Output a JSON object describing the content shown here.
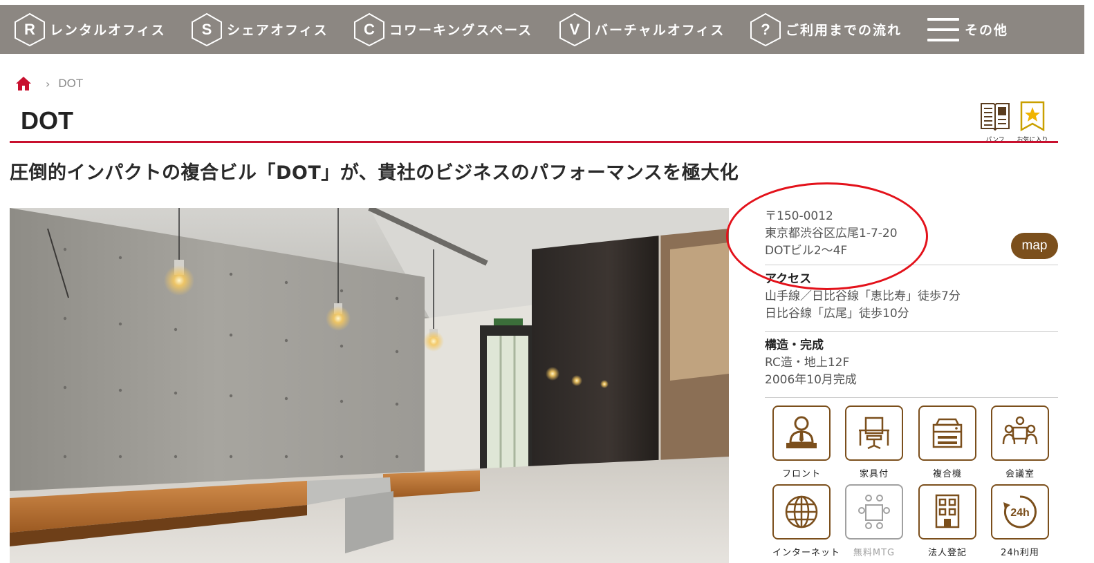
{
  "nav": {
    "items": [
      {
        "letter": "R",
        "label": "レンタルオフィス"
      },
      {
        "letter": "S",
        "label": "シェアオフィス"
      },
      {
        "letter": "C",
        "label": "コワーキングスペース"
      },
      {
        "letter": "V",
        "label": "バーチャルオフィス"
      },
      {
        "letter": "?",
        "label": "ご利用までの流れ"
      }
    ],
    "more_label": "その他"
  },
  "breadcrumb": {
    "current": "DOT"
  },
  "page": {
    "title": "DOT",
    "subtitle": "圧倒的インパクトの複合ビル「DOT」が、貴社のビジネスのパフォーマンスを極大化"
  },
  "tools": {
    "pamphlet_label": "パンフ",
    "favorite_label": "お気に入り"
  },
  "info": {
    "postal": "〒150-0012",
    "address": "東京都渋谷区広尾1-7-20",
    "building": "DOTビル2～4F",
    "map_label": "map",
    "access_heading": "アクセス",
    "access_lines": [
      "山手線／日比谷線「恵比寿」徒歩7分",
      "日比谷線「広尾」徒歩10分"
    ],
    "structure_heading": "構造・完成",
    "structure_lines": [
      "RC造・地上12F",
      "2006年10月完成"
    ]
  },
  "amenities": [
    {
      "icon": "front-desk-icon",
      "label": "フロント",
      "available": true
    },
    {
      "icon": "furniture-icon",
      "label": "家具付",
      "available": true
    },
    {
      "icon": "copier-icon",
      "label": "複合機",
      "available": true
    },
    {
      "icon": "meeting-room-icon",
      "label": "会議室",
      "available": true
    },
    {
      "icon": "internet-icon",
      "label": "インターネット",
      "available": true
    },
    {
      "icon": "free-meeting-icon",
      "label": "無料MTG",
      "available": false
    },
    {
      "icon": "registration-icon",
      "label": "法人登記",
      "available": true
    },
    {
      "icon": "24h-icon",
      "label": "24h利用",
      "available": true
    }
  ],
  "colors": {
    "nav_bg": "#8c8782",
    "accent_red": "#c8102e",
    "brown": "#7b4f1c",
    "annotation": "#e3121b"
  }
}
